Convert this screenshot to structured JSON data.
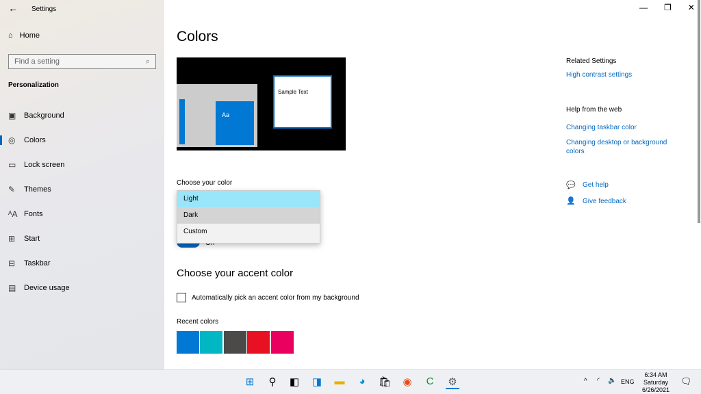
{
  "window": {
    "title": "Settings",
    "controls": [
      "minimize",
      "restore",
      "close"
    ]
  },
  "sidebar": {
    "home": "Home",
    "search_placeholder": "Find a setting",
    "section": "Personalization",
    "items": [
      {
        "label": "Background",
        "icon": "image-icon"
      },
      {
        "label": "Colors",
        "icon": "palette-icon",
        "active": true
      },
      {
        "label": "Lock screen",
        "icon": "lock-screen-icon"
      },
      {
        "label": "Themes",
        "icon": "brush-icon"
      },
      {
        "label": "Fonts",
        "icon": "font-icon"
      },
      {
        "label": "Start",
        "icon": "start-icon"
      },
      {
        "label": "Taskbar",
        "icon": "taskbar-icon"
      },
      {
        "label": "Device usage",
        "icon": "device-usage-icon"
      }
    ]
  },
  "main": {
    "title": "Colors",
    "preview": {
      "sample_text": "Sample Text",
      "tile_label": "Aa"
    },
    "choose_color": {
      "label": "Choose your color",
      "options": [
        "Light",
        "Dark",
        "Custom"
      ],
      "highlighted": "Light",
      "hovered": "Dark"
    },
    "toggle_label": "On",
    "accent_heading": "Choose your accent color",
    "auto_pick_label": "Automatically pick an accent color from my background",
    "auto_pick_checked": false,
    "recent_label": "Recent colors",
    "recent_colors": [
      "#0078d4",
      "#00b7c3",
      "#4c4a48",
      "#e81123",
      "#ea005e"
    ]
  },
  "related": {
    "heading": "Related Settings",
    "link": "High contrast settings",
    "web_heading": "Help from the web",
    "web_links": [
      "Changing taskbar color",
      "Changing desktop or background colors"
    ],
    "get_help": "Get help",
    "feedback": "Give feedback"
  },
  "taskbar": {
    "language": "ENG",
    "time": "6:34 AM",
    "day": "Saturday",
    "date": "6/26/2021"
  },
  "colors": {
    "accent": "#0067c0",
    "dropdown_highlight": "#99e6fb",
    "dropdown_hover": "#d4d4d4"
  }
}
